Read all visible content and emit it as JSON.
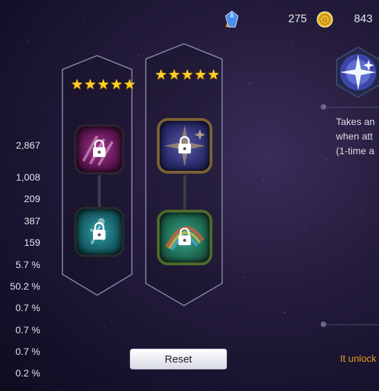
{
  "currency": {
    "gems": {
      "icon": "crystal-icon",
      "value": "275"
    },
    "gold": {
      "icon": "gold-coin-icon",
      "value": "843"
    }
  },
  "stats": [
    "2,867",
    "1,008",
    "209",
    "387",
    "159",
    "5.7 %",
    "50.2 %",
    "0.7 %",
    "0.7 %",
    "0.7 %",
    "0.2 %"
  ],
  "columns": [
    {
      "stars": 5,
      "skills": [
        {
          "icon": "claw-strike-icon",
          "locked": true
        },
        {
          "icon": "dash-figure-icon",
          "locked": true
        }
      ]
    },
    {
      "stars": 5,
      "skills": [
        {
          "icon": "compass-star-icon",
          "locked": true
        },
        {
          "icon": "rainbow-beast-icon",
          "locked": true
        }
      ]
    }
  ],
  "reset_label": "Reset",
  "detail": {
    "icon": "sparkle-star-icon",
    "description_lines": [
      "Takes an",
      "when att",
      "(1-time a"
    ],
    "unlock_text": "It unlock"
  },
  "colors": {
    "star": "#ffd02a",
    "unlock_text": "#e69a22",
    "frame": "#8c88b0"
  }
}
